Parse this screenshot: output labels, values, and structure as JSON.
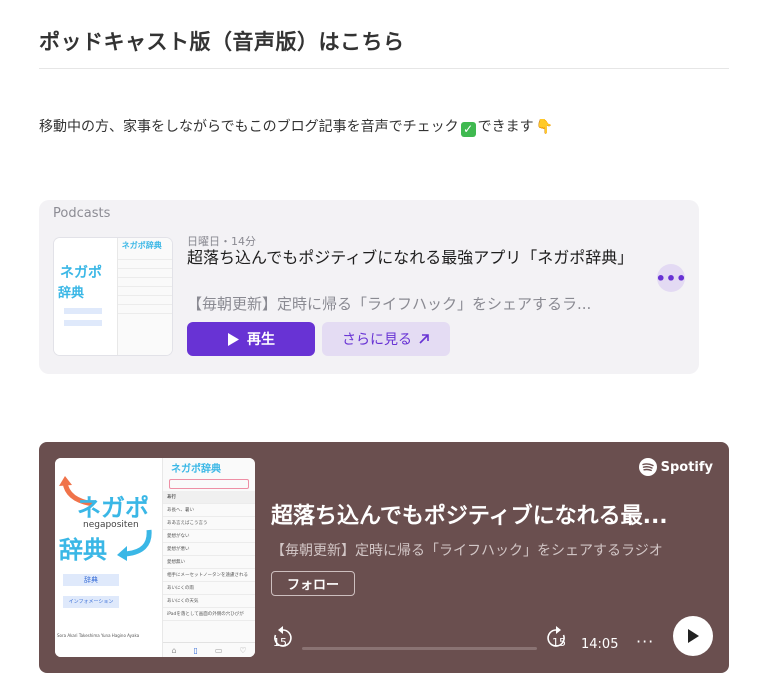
{
  "section": {
    "title": "ポッドキャスト版（音声版）はこちら",
    "intro_text": "移動中の方、家事をしながらでもこのブログ記事を音声でチェック",
    "intro_check": "✓",
    "intro_suffix": "できます",
    "intro_point": "👇"
  },
  "apple_podcasts": {
    "brand": "Podcasts",
    "meta": "日曜日・14分",
    "episode_title": "超落ち込んでもポジティブになれる最強アプリ「ネガポ辞典」",
    "show_name": "【毎朝更新】定時に帰る「ライフハック」をシェアするラ...",
    "play_label": "再生",
    "more_label": "さらに見る",
    "menu_glyph": "•••",
    "cover_logo": "ネガポ辞典"
  },
  "spotify": {
    "brand": "Spotify",
    "episode_title": "超落ち込んでもポジティブになれる最...",
    "show_name": "【毎朝更新】定時に帰る「ライフハック」をシェアするラジオ",
    "follow_label": "フォロー",
    "skip_back_label": "15",
    "skip_forward_label": "15",
    "time": "14:05",
    "menu_glyph": "···",
    "progress": 0.0,
    "cover_logo": "ネガポ辞典",
    "cover_title": "ネガポ",
    "cover_subtitle": "negapositen",
    "cover_title2": "辞典",
    "cover_btn1": "辞典",
    "cover_btn2": "インフォメーション",
    "cover_footer": "Sora Akari  Takeshima Yuna  Hagino Ayaka",
    "cover_list": [
      "あ行",
      "あ長へ、暑い",
      "ああ言えばこう言う",
      "愛想がない",
      "愛想が悪い",
      "愛想無い",
      "相手にメーセットノータンを遠慮される",
      "あいにくの雨",
      "あいにくの天気",
      "iPadを落として画面の外側の穴ひびが"
    ]
  },
  "colors": {
    "apple_accent": "#6833d4",
    "spotify_bg": "#6a4f4f",
    "cover_cyan": "#3ab7e6",
    "cover_orange": "#f0734a"
  }
}
